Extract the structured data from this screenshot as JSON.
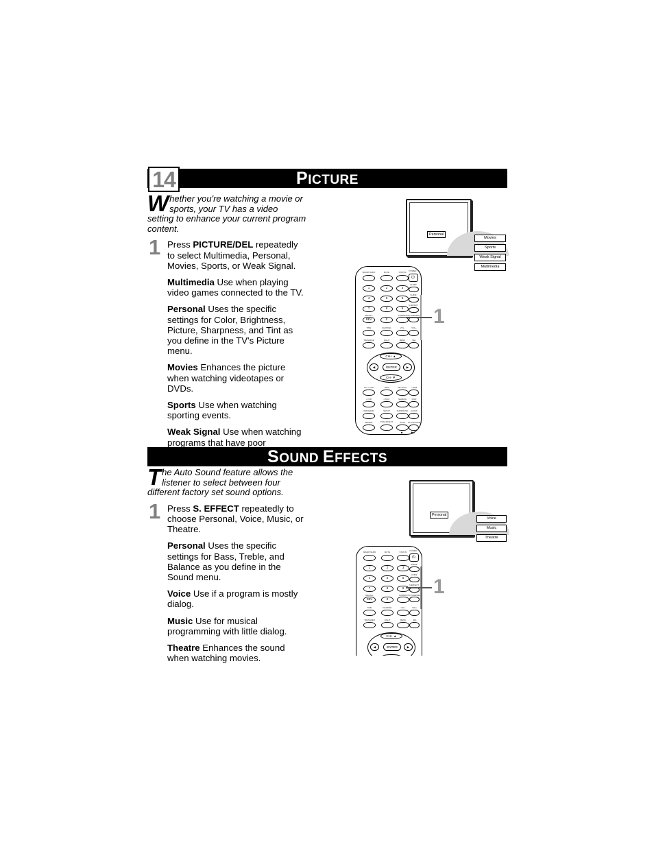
{
  "document": {
    "chapter_number": "14"
  },
  "sections": [
    {
      "id": "picture",
      "title_cap": "P",
      "title_rest": "icture",
      "intro_dropcap": "W",
      "intro_text": "hether you're watching a movie or sports, your TV has a video setting to enhance your current program content.",
      "step_number": "1",
      "step_lead_pre": "Press ",
      "step_lead_bold": "PICTURE/DEL",
      "step_lead_post": " repeatedly to select Multimedia, Personal, Movies, Sports, or Weak Signal.",
      "definitions": [
        {
          "term": "Multimedia",
          "desc": " Use when playing video games connected to the TV."
        },
        {
          "term": "Personal",
          "desc": " Uses the specific settings for Color, Brightness, Picture, Sharpness, and Tint as you define in the TV's Picture menu."
        },
        {
          "term": "Movies",
          "desc": " Enhances the picture when watching videotapes or DVDs."
        },
        {
          "term": "Sports",
          "desc": " Use when watching sporting events."
        },
        {
          "term": "Weak Signal",
          "desc": " Use when watching programs that have poor reception."
        }
      ],
      "tv": {
        "osd_label": "Personal",
        "options": [
          "Movies",
          "Sports",
          "Weak Signal",
          "Multimedia"
        ]
      },
      "callout": "1"
    },
    {
      "id": "sound",
      "title_cap": "S",
      "title_rest": "ound ",
      "title_cap2": "E",
      "title_rest2": "ffects",
      "intro_dropcap": "T",
      "intro_text": "he Auto Sound feature allows the listener to select between four different factory set sound options.",
      "step_number": "1",
      "step_lead_pre": "Press ",
      "step_lead_bold": "S. EFFECT",
      "step_lead_post": " repeatedly to choose Personal, Voice, Music, or Theatre.",
      "definitions": [
        {
          "term": "Personal",
          "desc": " Uses the specific settings for Bass, Treble, and Balance as you define in the Sound menu."
        },
        {
          "term": "Voice",
          "desc": " Use if a program is mostly dialog."
        },
        {
          "term": "Music",
          "desc": " Use for musical programming with little dialog."
        },
        {
          "term": "Theatre",
          "desc": " Enhances the sound when watching movies."
        }
      ],
      "tv": {
        "osd_label": "Personal",
        "options": [
          "Voice",
          "Music",
          "Theatre"
        ]
      },
      "callout": "1"
    }
  ],
  "remote": {
    "row_labels_top": [
      "SMART/SURF",
      "MUTE",
      "STATUS",
      "POWER"
    ],
    "keypad_rows": [
      [
        "1",
        "2",
        "3"
      ],
      [
        "4",
        "5",
        "6"
      ],
      [
        "7",
        "8",
        "9"
      ]
    ],
    "keypad_side_labels": [
      "SLEEP",
      "GUIDE",
      "S.EFFECT",
      "PICTURE/DEL"
    ],
    "recall_label": "RECALL",
    "recall_text": "REV",
    "zero_text": "0",
    "format_label": "FORMAT",
    "row_labels_mid": [
      "TIME",
      "CHANNEL",
      "VOL-",
      "VOL+"
    ],
    "row_labels_low": [
      "TRANSFER",
      "LIGHT",
      "MENU",
      "SEL"
    ],
    "nav": {
      "up": "CH+ ▲",
      "down": "CH- ▼",
      "left": "◀",
      "right": "▶",
      "center": "ENTER"
    },
    "row_labels_b1": [
      "AV+ / CCD",
      "• REC",
      "AB • EXIT",
      "• TAPE"
    ],
    "row_labels_b2": [
      "• VCR",
      "• PLAY",
      "SEARCH",
      "FIND"
    ],
    "row_labels_b3": [
      "PROGRAM",
      "SETUP",
      "SURROUND",
      "CLOCK"
    ],
    "row_labels_b4": [
      "REPEAT",
      "TRACK/NEXT",
      "STOP",
      "PLAY/PAUSE"
    ],
    "glyph_stop": "■",
    "glyph_play": "▶‖",
    "power_glyph": "⏻"
  },
  "colors": {
    "bar_background": "#000000",
    "bar_text": "#ffffff",
    "chapter_number": "#808080",
    "step_number": "#808080",
    "callout": "#9a9a9a",
    "swoosh": "#d9d9d9"
  }
}
